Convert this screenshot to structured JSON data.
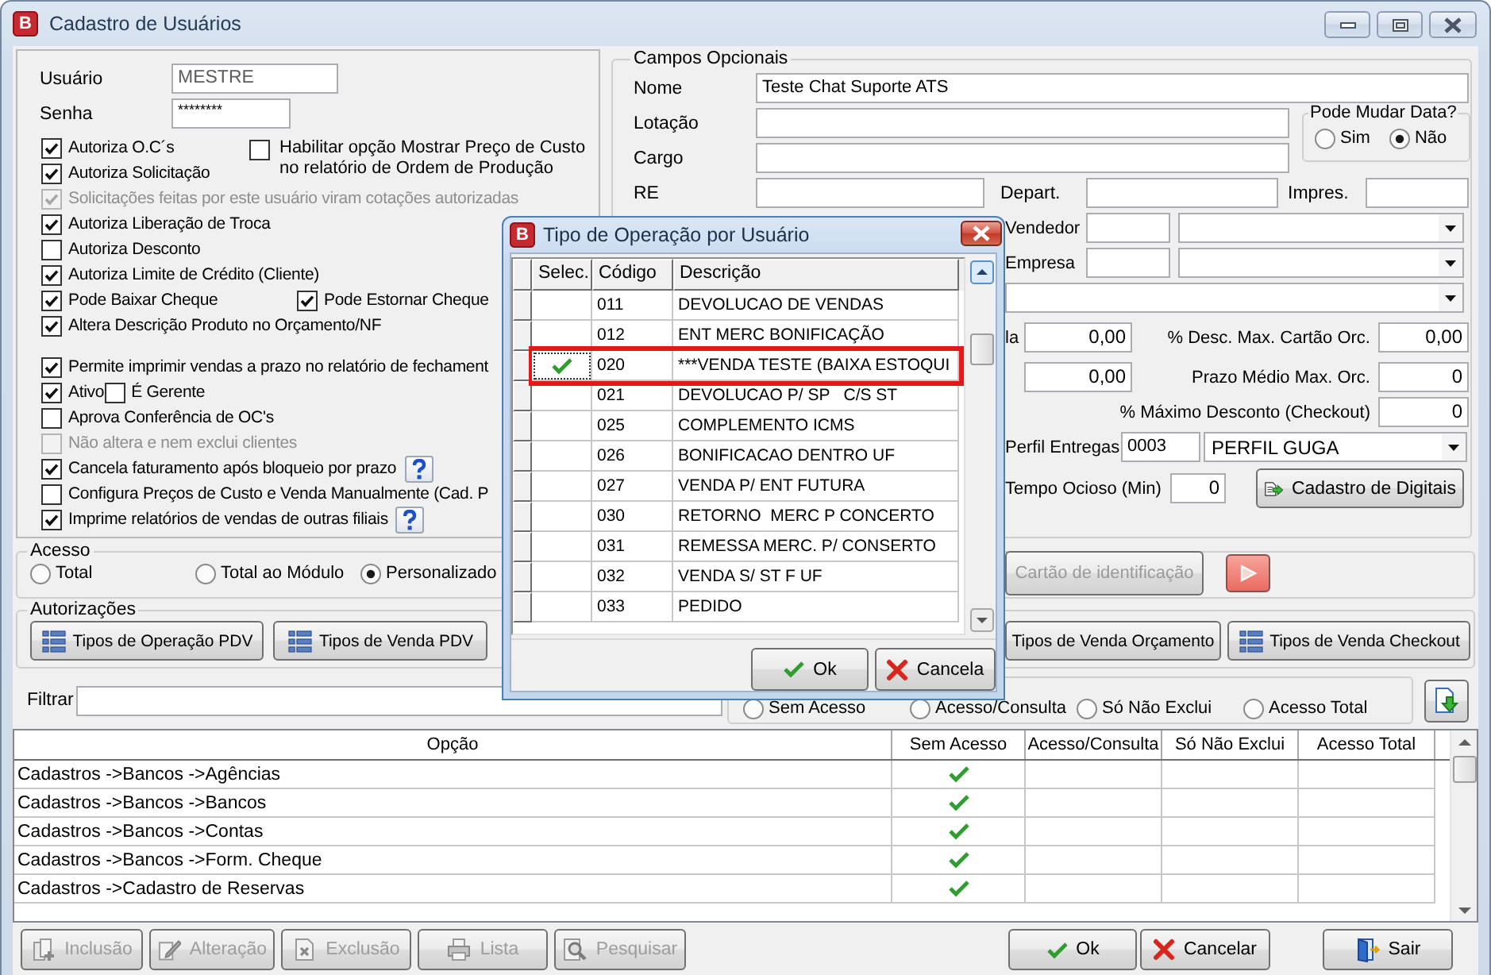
{
  "window": {
    "logo": "B",
    "title": "Cadastro de Usuários"
  },
  "user_panel": {
    "fields": [
      {
        "label": "Usuário",
        "value": "MESTRE",
        "kind": "readonly"
      },
      {
        "label": "Senha",
        "value": "********",
        "kind": "password"
      }
    ],
    "permission_groups": [
      {
        "side_option": {
          "label": "Habilitar opção Mostrar Preço de Custo no relatório de Ordem de Produção",
          "checked": false
        },
        "rows": [
          {
            "kind": "single",
            "help": false,
            "items": [
              {
                "label": "Autoriza O.C´s",
                "checked": true,
                "disabled": false
              }
            ]
          },
          {
            "kind": "single",
            "help": false,
            "items": [
              {
                "label": "Autoriza Solicitação",
                "checked": true,
                "disabled": false
              }
            ]
          },
          {
            "kind": "single",
            "help": false,
            "items": [
              {
                "label": "Solicitações feitas por este usuário viram cotações autorizadas",
                "checked": true,
                "disabled": true
              }
            ]
          },
          {
            "kind": "single",
            "help": false,
            "items": [
              {
                "label": "Autoriza Liberação de Troca",
                "checked": true,
                "disabled": false
              }
            ]
          },
          {
            "kind": "single",
            "help": false,
            "items": [
              {
                "label": "Autoriza Desconto",
                "checked": false,
                "disabled": false
              }
            ]
          },
          {
            "kind": "single",
            "help": false,
            "items": [
              {
                "label": "Autoriza Limite de Crédito (Cliente)",
                "checked": true,
                "disabled": false
              }
            ]
          },
          {
            "kind": "columns",
            "help": false,
            "items": [
              {
                "label": "Pode Baixar Cheque",
                "checked": true,
                "disabled": false
              },
              {
                "label": "Pode Estornar Cheque",
                "checked": true,
                "disabled": false
              }
            ]
          },
          {
            "kind": "single",
            "help": false,
            "items": [
              {
                "label": "Altera Descrição Produto no Orçamento/NF",
                "checked": true,
                "disabled": false
              }
            ]
          }
        ]
      },
      {
        "rows": [
          {
            "kind": "single",
            "help": false,
            "items": [
              {
                "label": "Permite imprimir vendas a prazo no relatório de fechament",
                "checked": true,
                "disabled": false
              }
            ]
          },
          {
            "kind": "inline",
            "help": false,
            "items": [
              {
                "label": "Ativo",
                "checked": true,
                "disabled": false
              },
              {
                "label": "É Gerente",
                "checked": false,
                "disabled": false
              }
            ]
          },
          {
            "kind": "single",
            "help": false,
            "items": [
              {
                "label": "Aprova Conferência de OC's",
                "checked": false,
                "disabled": false
              }
            ]
          },
          {
            "kind": "single",
            "help": false,
            "items": [
              {
                "label": "Não altera e nem exclui clientes",
                "checked": false,
                "disabled": true
              }
            ]
          },
          {
            "kind": "single",
            "help": true,
            "items": [
              {
                "label": "Cancela faturamento após bloqueio por prazo",
                "checked": true,
                "disabled": false
              }
            ]
          },
          {
            "kind": "single",
            "help": false,
            "items": [
              {
                "label": "Configura Preços de Custo e Venda Manualmente (Cad. P",
                "checked": false,
                "disabled": false
              }
            ]
          },
          {
            "kind": "single",
            "help": true,
            "items": [
              {
                "label": "Imprime relatórios de vendas de outras filiais",
                "checked": true,
                "disabled": false
              }
            ]
          }
        ]
      }
    ]
  },
  "optional_fields": {
    "title": "Campos Opcionais",
    "name": {
      "label": "Nome",
      "value": "Teste Chat Suporte ATS"
    },
    "lotacao": {
      "label": "Lotação"
    },
    "cargo": {
      "label": "Cargo"
    },
    "date_change": {
      "title": "Pode Mudar Data?",
      "options": [
        {
          "label": "Sim",
          "selected": false
        },
        {
          "label": "Não",
          "selected": true
        }
      ]
    },
    "re": {
      "label": "RE"
    },
    "depart": {
      "label": "Depart."
    },
    "impres": {
      "label": "Impres."
    },
    "vendedor": {
      "label": "Vendedor"
    },
    "empresa": {
      "label": "Empresa"
    },
    "limit_rows": [
      {
        "left_label": "la",
        "left_value": "0,00",
        "label": "% Desc. Max. Cartão Orc.",
        "value": "0,00"
      },
      {
        "left_value": "0,00",
        "label": "Prazo Médio Max. Orc.",
        "value": "0"
      },
      {
        "label": "% Máximo Desconto (Checkout)",
        "value": "0"
      }
    ],
    "perfil_entregas": {
      "label": "Perfil Entregas",
      "code": "0003",
      "value": "PERFIL GUGA"
    },
    "tempo_ocioso": {
      "label": "Tempo Ocioso (Min)",
      "value": "0"
    },
    "digitais_button": "Cadastro de Digitais"
  },
  "access": {
    "title": "Acesso",
    "options": [
      {
        "label": "Total",
        "selected": false
      },
      {
        "label": "Total ao Módulo",
        "selected": false
      },
      {
        "label": "Personalizado",
        "selected": true
      }
    ],
    "card_button": {
      "label": "Cartão de identificação",
      "disabled": true
    }
  },
  "authorizations": {
    "title": "Autorizações",
    "left_buttons": [
      "Tipos de Operação PDV",
      "Tipos de Venda PDV"
    ],
    "right_buttons": [
      "Tipos de Venda Orçamento",
      "Tipos de Venda Checkout"
    ]
  },
  "filter": {
    "label": "Filtrar"
  },
  "access_levels": {
    "options": [
      {
        "label": "Sem Acesso",
        "selected": false
      },
      {
        "label": "Acesso/Consulta",
        "selected": false
      },
      {
        "label": "Só Não Exclui",
        "selected": false
      },
      {
        "label": "Acesso Total",
        "selected": false
      }
    ]
  },
  "table": {
    "columns": [
      "Opção",
      "Sem Acesso",
      "Acesso/Consulta",
      "Só Não Exclui",
      "Acesso Total"
    ],
    "rows": [
      {
        "option": "Cadastros ->Bancos ->Agências",
        "checks": [
          true,
          false,
          false,
          false
        ]
      },
      {
        "option": "Cadastros ->Bancos ->Bancos",
        "checks": [
          true,
          false,
          false,
          false
        ]
      },
      {
        "option": "Cadastros ->Bancos ->Contas",
        "checks": [
          true,
          false,
          false,
          false
        ]
      },
      {
        "option": "Cadastros ->Bancos ->Form. Cheque",
        "checks": [
          true,
          false,
          false,
          false
        ]
      },
      {
        "option": "Cadastros ->Cadastro de Reservas",
        "checks": [
          true,
          false,
          false,
          false
        ]
      }
    ]
  },
  "toolbar": {
    "buttons": [
      {
        "label": "Inclusão",
        "kind": "insert",
        "disabled": true
      },
      {
        "label": "Alteração",
        "kind": "edit",
        "disabled": true
      },
      {
        "label": "Exclusão",
        "kind": "delete",
        "disabled": true
      },
      {
        "label": "Lista",
        "kind": "print",
        "disabled": true
      },
      {
        "label": "Pesquisar",
        "kind": "search",
        "disabled": true
      }
    ],
    "actions": [
      {
        "label": "Ok",
        "kind": "ok"
      },
      {
        "label": "Cancelar",
        "kind": "cancel"
      },
      {
        "label": "Sair",
        "kind": "exit"
      }
    ]
  },
  "dialog": {
    "logo": "B",
    "title": "Tipo de Operação por Usuário",
    "columns": [
      "Selec.",
      "Código",
      "Descrição"
    ],
    "rows": [
      {
        "code": "011",
        "description": "DEVOLUCAO DE VENDAS",
        "selected": false,
        "highlighted": false
      },
      {
        "code": "012",
        "description": "ENT MERC BONIFICAÇÃO",
        "selected": false,
        "highlighted": false
      },
      {
        "code": "020",
        "description": "***VENDA TESTE (BAIXA ESTOQUI",
        "selected": true,
        "highlighted": true
      },
      {
        "code": "021",
        "description": "DEVOLUCAO P/ SP   C/S ST",
        "selected": false,
        "highlighted": false
      },
      {
        "code": "025",
        "description": "COMPLEMENTO ICMS",
        "selected": false,
        "highlighted": false
      },
      {
        "code": "026",
        "description": "BONIFICACAO DENTRO UF",
        "selected": false,
        "highlighted": false
      },
      {
        "code": "027",
        "description": "VENDA P/ ENT FUTURA",
        "selected": false,
        "highlighted": false
      },
      {
        "code": "030",
        "description": "RETORNO  MERC P CONCERTO",
        "selected": false,
        "highlighted": false
      },
      {
        "code": "031",
        "description": "REMESSA MERC. P/ CONSERTO",
        "selected": false,
        "highlighted": false
      },
      {
        "code": "032",
        "description": "VENDA S/ ST F UF",
        "selected": false,
        "highlighted": false
      },
      {
        "code": "033",
        "description": "PEDIDO",
        "selected": false,
        "highlighted": false
      }
    ],
    "buttons": [
      {
        "label": "Ok",
        "kind": "ok"
      },
      {
        "label": "Cancela",
        "kind": "cancel"
      }
    ]
  }
}
